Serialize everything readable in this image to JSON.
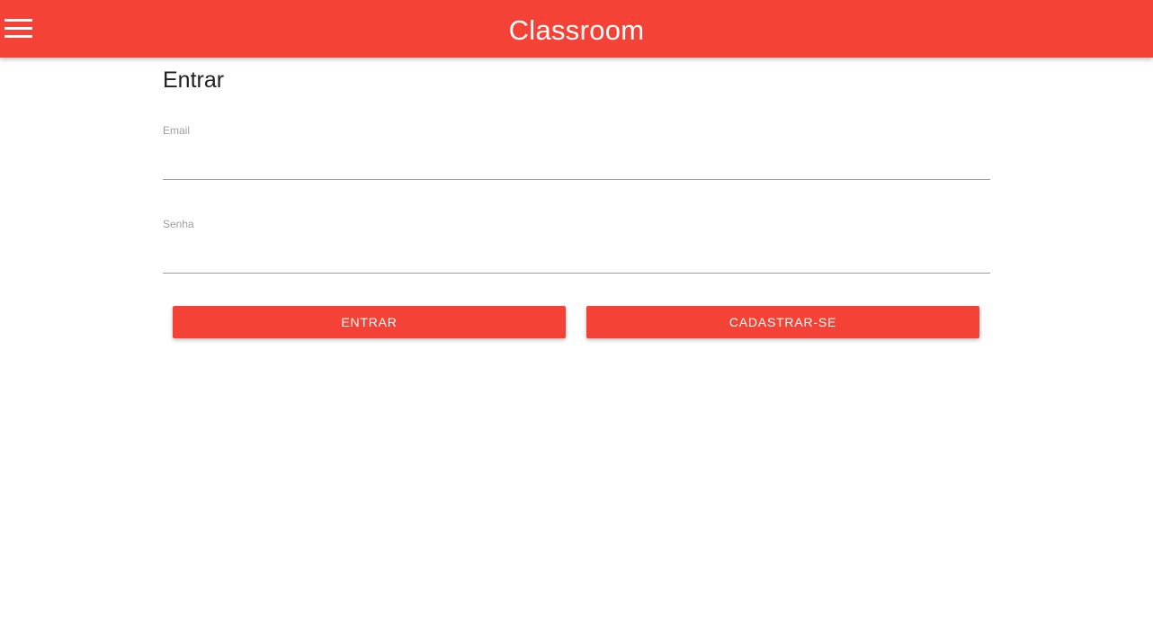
{
  "app_bar": {
    "title": "Classroom",
    "menu_icon": "menu-icon",
    "color": "#f44336"
  },
  "page": {
    "title": "Entrar"
  },
  "form": {
    "email": {
      "label": "Email",
      "value": "",
      "placeholder": ""
    },
    "password": {
      "label": "Senha",
      "value": "",
      "placeholder": ""
    }
  },
  "buttons": {
    "login_label": "Entrar",
    "signup_label": "Cadastrar-se"
  }
}
